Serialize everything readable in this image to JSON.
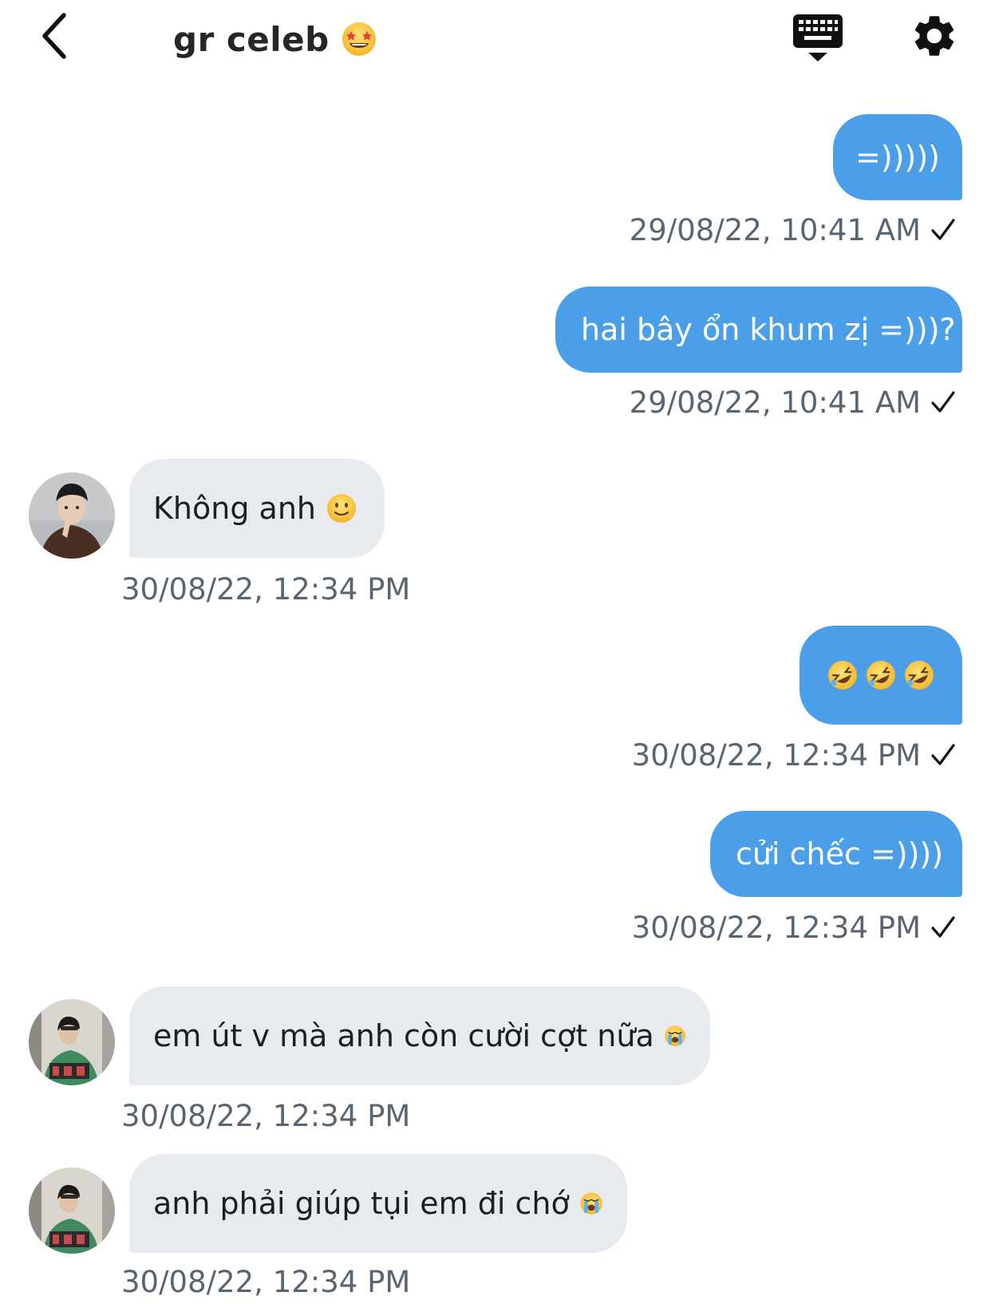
{
  "header": {
    "title": "gr celeb",
    "title_emoji": "star-struck-emoji",
    "back_icon": "chevron-left-icon",
    "keyboard_icon": "keyboard-dismiss-icon",
    "settings_icon": "gear-icon"
  },
  "colors": {
    "outgoing_bubble": "#4a9fe8",
    "incoming_bubble": "#e7ebee",
    "timestamp": "#586572"
  },
  "messages": [
    {
      "direction": "out",
      "text": "=)))))",
      "timestamp": "29/08/22, 10:41 AM",
      "read": true
    },
    {
      "direction": "out",
      "text": "hai bây ổn khum zị =)))?",
      "timestamp": "29/08/22, 10:41 AM",
      "read": true
    },
    {
      "direction": "in",
      "text": "Không anh",
      "emoji": "slightly-smiling-face",
      "timestamp": "30/08/22, 12:34 PM"
    },
    {
      "direction": "out",
      "text": "",
      "emoji": "rolling-on-floor-laughing x3",
      "timestamp": "30/08/22, 12:34 PM",
      "read": true
    },
    {
      "direction": "out",
      "text": "cửi chếc =))))",
      "timestamp": "30/08/22, 12:34 PM",
      "read": true
    },
    {
      "direction": "in",
      "text": "em út v mà anh còn cười cợt nữa",
      "emoji": "loudly-crying-face",
      "timestamp": "30/08/22, 12:34 PM"
    },
    {
      "direction": "in",
      "text": "anh phải giúp tụi em đi chớ",
      "emoji": "loudly-crying-face",
      "timestamp": "30/08/22, 12:34 PM"
    }
  ]
}
